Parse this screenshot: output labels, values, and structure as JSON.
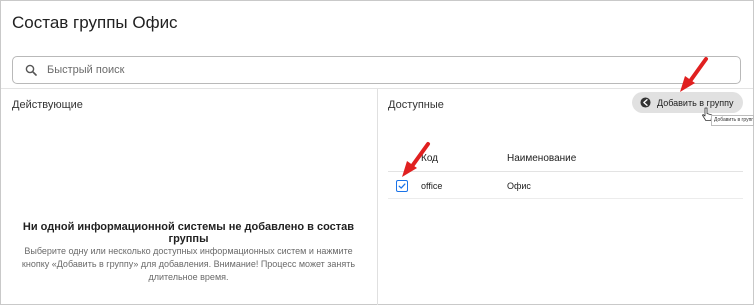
{
  "page": {
    "title": "Состав группы Офис"
  },
  "search": {
    "placeholder": "Быстрый поиск",
    "icon": "search-icon"
  },
  "active_panel": {
    "title": "Действующие",
    "empty_title": "Ни одной информационной системы не добавлено в состав группы",
    "empty_description": "Выберите одну или несколько доступных информационных систем и нажмите кнопку «Добавить в группу» для добавления. Внимание! Процесс может занять длительное время."
  },
  "available_panel": {
    "title": "Доступные",
    "add_button_label": "Добавить в группу",
    "add_button_icon": "arrow-left-circle-icon",
    "tooltip": "Добавить в группу",
    "columns": {
      "code": "Код",
      "name": "Наименование"
    },
    "rows": [
      {
        "checked": true,
        "code": "office",
        "name": "Офис"
      }
    ]
  },
  "colors": {
    "accent": "#1a73e8",
    "annotation_arrow": "#e02020",
    "button_bg": "#e1e1e1"
  }
}
